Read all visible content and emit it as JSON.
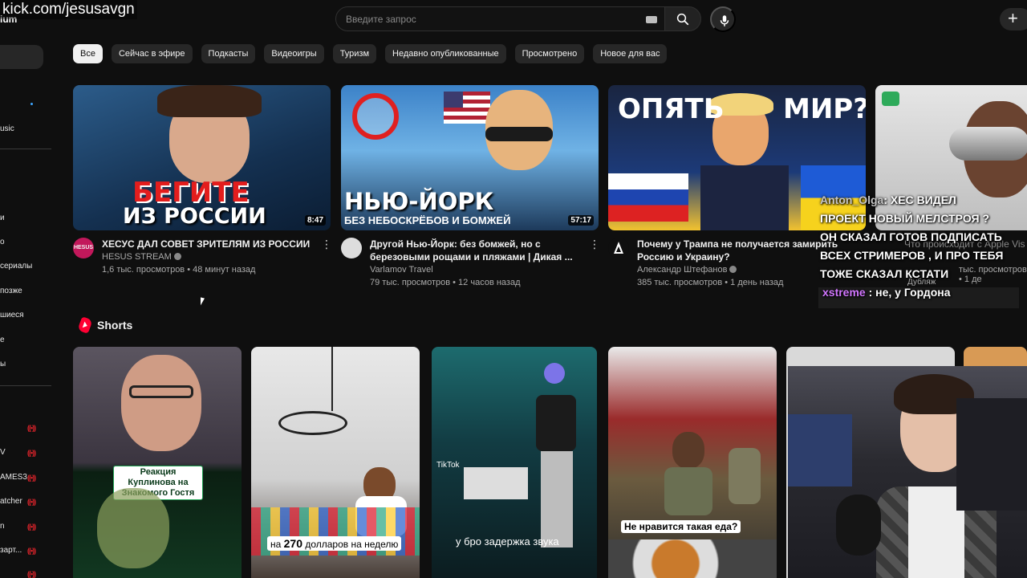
{
  "overlay": {
    "watermark": "kick.com/jesusavgn",
    "logo_fragment": "ium"
  },
  "search": {
    "placeholder": "Введите запрос"
  },
  "chips": [
    "Все",
    "Сейчас в эфире",
    "Подкасты",
    "Видеоигры",
    "Туризм",
    "Недавно опубликованные",
    "Просмотрено",
    "Новое для вас"
  ],
  "sidebar": {
    "items": [
      {
        "label": "usic"
      },
      {
        "label": "и"
      },
      {
        "label": "о"
      },
      {
        "label": "сериалы"
      },
      {
        "label": "позже"
      },
      {
        "label": "шиеся"
      },
      {
        "label": "е"
      },
      {
        "label": "ы"
      }
    ],
    "live_items": [
      {
        "label": ""
      },
      {
        "label": "V"
      },
      {
        "label": "AMES3"
      },
      {
        "label": "atcher"
      },
      {
        "label": "n"
      },
      {
        "label": "зарт..."
      },
      {
        "label": ""
      }
    ]
  },
  "videos": [
    {
      "title": "ХЕСУС ДАЛ СОВЕТ ЗРИТЕЛЯМ ИЗ РОССИИ",
      "channel": "HESUS STREAM",
      "verified": true,
      "stats": "1,6 тыс. просмотров • 48 минут назад",
      "duration": "8:47",
      "thumb_text_1": "БЕГИТЕ",
      "thumb_text_2": "ИЗ РОССИИ",
      "avatar_text": "HESUS"
    },
    {
      "title": "Другой Нью-Йорк: без бомжей, но с березовыми рощами и пляжами | Дикая ...",
      "channel": "Varlamov Travel",
      "verified": false,
      "stats": "79 тыс. просмотров • 12 часов назад",
      "duration": "57:17",
      "thumb_text_1": "НЬЮ-ЙОРК",
      "thumb_text_2": "БЕЗ НЕБОСКРЁБОВ И БОМЖЕЙ"
    },
    {
      "title": "Почему у Трампа не получается замирить Россию и Украину?",
      "channel": "Александр Штефанов",
      "verified": true,
      "stats": "385 тыс. просмотров • 1 день назад",
      "thumb_text_1": "ОПЯТЬ",
      "thumb_text_2": "МИР?"
    },
    {
      "title": "Что происходит с Apple Vis",
      "stats_partial": "тыс. просмотров • 1 де",
      "badge": "Дубляж"
    }
  ],
  "chat": [
    {
      "user": "Anton_Olga",
      "text": ": ХЕС ВИДЕЛ"
    },
    {
      "user": "",
      "text": "ПРОЕКТ НОВЫЙ МЕЛСТРОЯ ?"
    },
    {
      "user": "",
      "text": "ОН СКАЗАЛ ГОТОВ ПОДПИСАТЬ"
    },
    {
      "user": "",
      "text": "ВСЕХ СТРИМЕРОВ , И ПРО ТЕБЯ"
    },
    {
      "user": "",
      "text": "ТОЖЕ СКАЗАЛ КСТАТИ"
    },
    {
      "user": "xstreme",
      "text": " : не, у Гордона"
    }
  ],
  "shorts": {
    "title": "Shorts",
    "items": [
      {
        "caption": "Реакция Куплинова на Знакомого Гостя"
      },
      {
        "caption_pre": "на ",
        "caption_num": "270",
        "caption_post": " долларов на неделю"
      },
      {
        "caption": "у бро задержка звука",
        "tiktok": "TikTok"
      },
      {
        "caption": "Не нравится такая еда?"
      },
      {
        "caption": ""
      }
    ]
  },
  "colors": {
    "background": "#0f0f0f",
    "chip_bg": "#272727",
    "chip_active_bg": "#f1f1f1",
    "live_red": "#e0242b",
    "shorts_red": "#ff0033"
  }
}
